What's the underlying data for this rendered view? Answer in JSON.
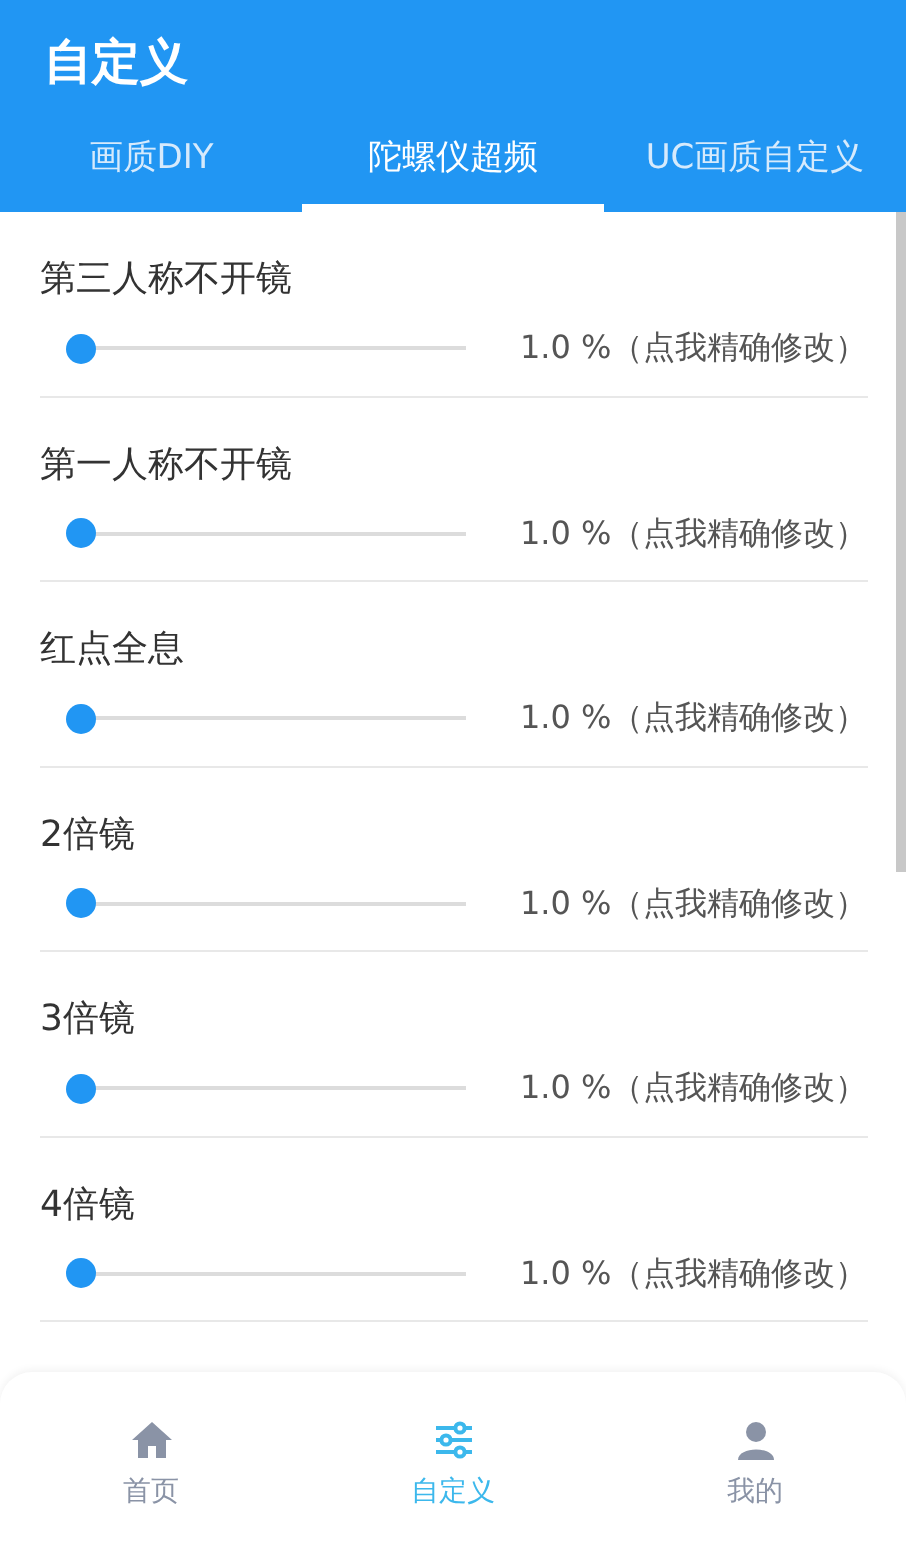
{
  "header": {
    "title": "自定义"
  },
  "tabs": [
    {
      "label": "画质DIY",
      "selected": false
    },
    {
      "label": "陀螺仪超频",
      "selected": true
    },
    {
      "label": "UC画质自定义",
      "selected": false
    }
  ],
  "settings": [
    {
      "name": "第三人称不开镜",
      "level": 0,
      "reading": "1.0 %（点我精确修改）"
    },
    {
      "name": "第一人称不开镜",
      "level": 0,
      "reading": "1.0 %（点我精确修改）"
    },
    {
      "name": "红点全息",
      "level": 0,
      "reading": "1.0 %（点我精确修改）"
    },
    {
      "name": "2倍镜",
      "level": 0,
      "reading": "1.0 %（点我精确修改）"
    },
    {
      "name": "3倍镜",
      "level": 0,
      "reading": "1.0 %（点我精确修改）"
    },
    {
      "name": "4倍镜",
      "level": 0,
      "reading": "1.0 %（点我精确修改）"
    }
  ],
  "bottom_nav": [
    {
      "label": "首页",
      "kind": "home",
      "selected": false
    },
    {
      "label": "自定义",
      "kind": "sliders",
      "selected": true
    },
    {
      "label": "我的",
      "kind": "user",
      "selected": false
    }
  ]
}
